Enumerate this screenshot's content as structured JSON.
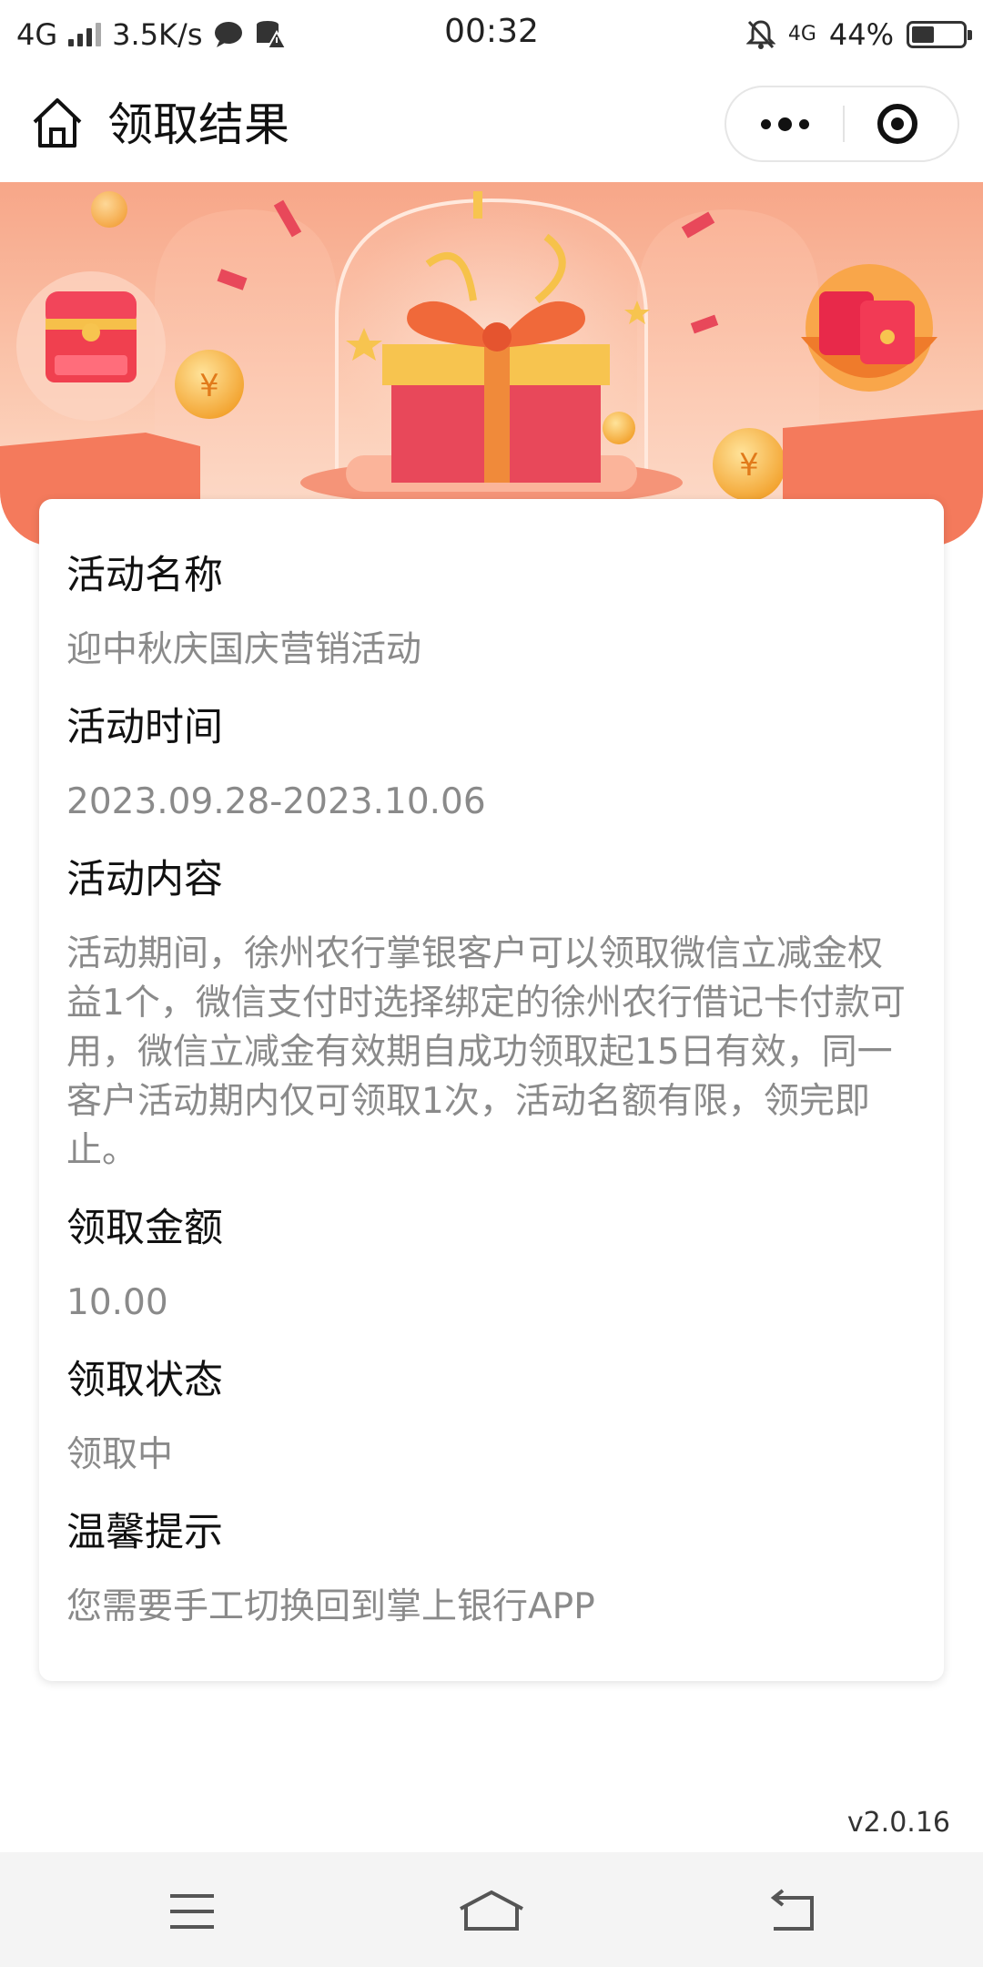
{
  "status_bar": {
    "network": "4G",
    "speed": "3.5K/s",
    "time": "00:32",
    "network_right": "4G",
    "battery_text": "44%",
    "battery_level": 0.44
  },
  "nav": {
    "title": "领取结果"
  },
  "sections": [
    {
      "label": "活动名称",
      "value": "迎中秋庆国庆营销活动"
    },
    {
      "label": "活动时间",
      "value": "2023.09.28-2023.10.06"
    },
    {
      "label": "活动内容",
      "value": "活动期间，徐州农行掌银客户可以领取微信立减金权益1个，微信支付时选择绑定的徐州农行借记卡付款可用，微信立减金有效期自成功领取起15日有效，同一客户活动期内仅可领取1次，活动名额有限，领完即止。"
    },
    {
      "label": "领取金额",
      "value": "10.00"
    },
    {
      "label": "领取状态",
      "value": "领取中"
    },
    {
      "label": "温馨提示",
      "value": "您需要手工切换回到掌上银行APP"
    }
  ],
  "version": "v2.0.16",
  "colors": {
    "banner_top": "#f7a688",
    "gift_red": "#e8485a",
    "ribbon": "#f08a3a",
    "coin": "#f7b53a"
  },
  "icons": {
    "home": "home-icon",
    "more": "more-dots-icon",
    "close": "target-close-icon",
    "menu": "menu-icon",
    "sys_home": "system-home-icon",
    "back": "back-icon"
  }
}
